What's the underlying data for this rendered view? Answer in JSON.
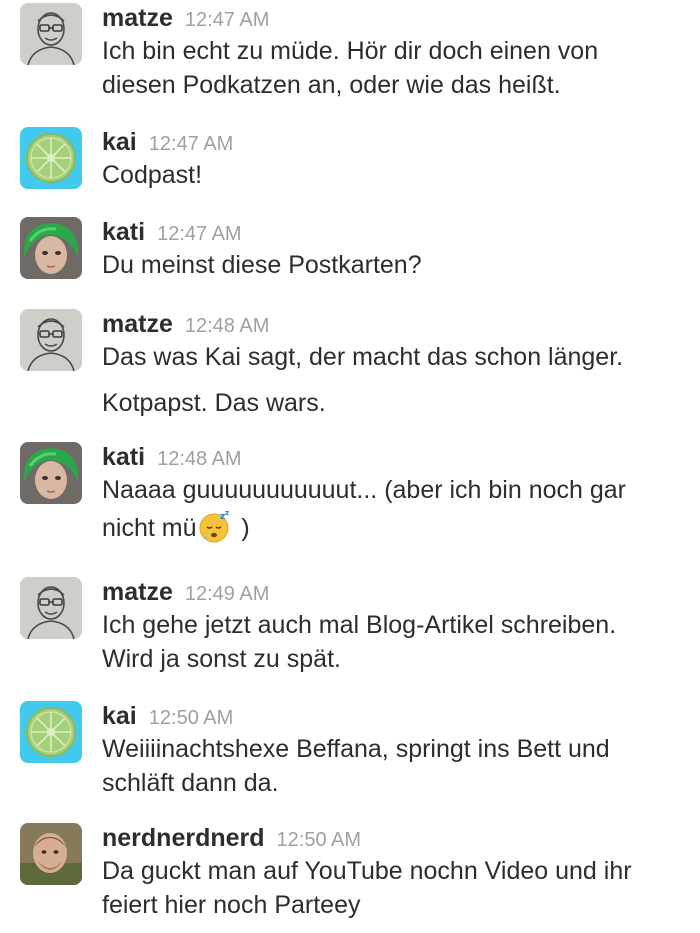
{
  "messages": [
    {
      "user": "matze",
      "time": "12:47 AM",
      "avatar": "sketch-portrait-avatar",
      "lines": [
        "Ich bin echt zu müde. Hör dir doch einen von",
        "diesen Podkatzen an, oder wie das heißt."
      ]
    },
    {
      "user": "kai",
      "time": "12:47 AM",
      "avatar": "citrus-slice-avatar",
      "lines": [
        "Codpast!"
      ]
    },
    {
      "user": "kati",
      "time": "12:47 AM",
      "avatar": "green-hair-photo-avatar",
      "lines": [
        "Du meinst diese Postkarten?"
      ]
    },
    {
      "user": "matze",
      "time": "12:48 AM",
      "avatar": "sketch-portrait-avatar",
      "lines": [
        "Das was Kai sagt, der macht das schon länger."
      ],
      "extra": "Kotpapst. Das wars."
    },
    {
      "user": "kati",
      "time": "12:48 AM",
      "avatar": "green-hair-photo-avatar",
      "lines": [
        "Naaaa guuuuuuuuuuut... (aber ich bin noch gar"
      ],
      "tail_before": "nicht mü",
      "tail_emoji": "sleeping-face-emoji",
      "tail_after": " )"
    },
    {
      "user": "matze",
      "time": "12:49 AM",
      "avatar": "sketch-portrait-avatar",
      "lines": [
        "Ich gehe jetzt auch mal Blog-Artikel schreiben.",
        "Wird ja sonst zu spät."
      ]
    },
    {
      "user": "kai",
      "time": "12:50 AM",
      "avatar": "citrus-slice-avatar",
      "lines": [
        "Weiiiinachtshexe Beffana, springt ins Bett und",
        "schläft dann da."
      ]
    },
    {
      "user": "nerdnerdnerd",
      "time": "12:50 AM",
      "avatar": "photo-avatar",
      "lines": [
        "Da guckt man auf YouTube nochn Video und ihr",
        "feiert hier noch Parteey"
      ]
    }
  ],
  "colors": {
    "username": "#2c2d30",
    "timestamp": "#a0a0a2",
    "text": "#2c2d30",
    "citrus_bg": "#41c9ee",
    "citrus_fruit": "#a6cf7a"
  }
}
